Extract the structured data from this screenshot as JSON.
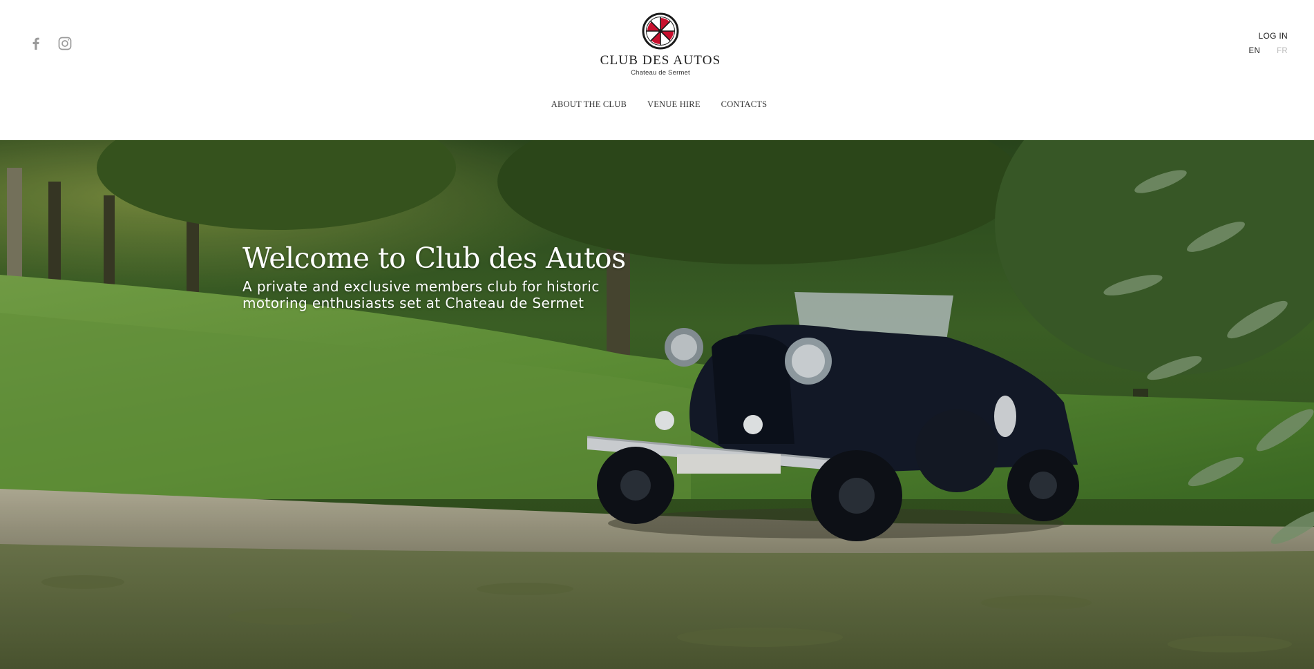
{
  "social": {
    "items": [
      {
        "icon": "facebook-icon",
        "label": "Facebook"
      },
      {
        "icon": "instagram-icon",
        "label": "Instagram"
      }
    ]
  },
  "logo": {
    "name": "CLUB DES AUTOS",
    "subtitle": "Chateau de Sermet",
    "colors": {
      "accent": "#c8102e",
      "dark": "#1a1a1a"
    }
  },
  "nav": {
    "items": [
      {
        "label": "ABOUT THE CLUB"
      },
      {
        "label": "VENUE HIRE"
      },
      {
        "label": "CONTACTS"
      }
    ]
  },
  "account": {
    "login_label": "LOG IN",
    "languages": [
      {
        "code": "EN",
        "active": true
      },
      {
        "code": "FR",
        "active": false
      }
    ]
  },
  "hero": {
    "title": "Welcome to Club des Autos",
    "subtitle": "A private and exclusive members club for historic motoring enthusiasts set at Chateau de Sermet"
  }
}
